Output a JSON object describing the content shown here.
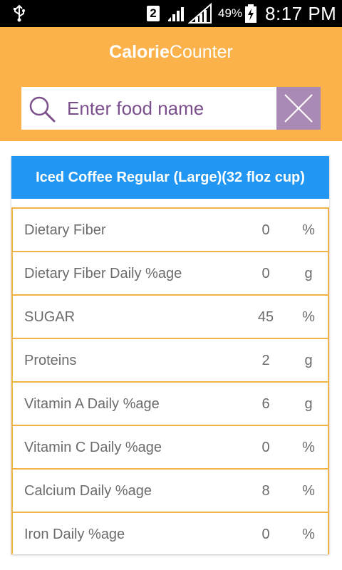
{
  "status_bar": {
    "sim_slot": "2",
    "battery_percent": "49%",
    "time": "8:17 PM"
  },
  "app": {
    "title_bold": "Calorie",
    "title_regular": "Counter"
  },
  "search": {
    "placeholder": "Enter food name",
    "value": ""
  },
  "food": {
    "name": "Iced Coffee Regular (Large)(32 floz cup)"
  },
  "nutrients": [
    {
      "name": "Dietary Fiber",
      "value": "0",
      "unit": "%"
    },
    {
      "name": "Dietary Fiber Daily %age",
      "value": "0",
      "unit": "g"
    },
    {
      "name": "SUGAR",
      "value": "45",
      "unit": "%"
    },
    {
      "name": "Proteins",
      "value": "2",
      "unit": "g"
    },
    {
      "name": "Vitamin A Daily %age",
      "value": "6",
      "unit": "g"
    },
    {
      "name": "Vitamin C Daily %age",
      "value": "0",
      "unit": "%"
    },
    {
      "name": "Calcium Daily %age",
      "value": "8",
      "unit": "%"
    },
    {
      "name": "Iron Daily %age",
      "value": "0",
      "unit": "%"
    }
  ],
  "colors": {
    "header_bg": "#fbb24b",
    "card_header_bg": "#2196f3",
    "row_border": "#f1b347",
    "search_text": "#7a4f8c",
    "clear_button_bg": "#a98ab5"
  },
  "icons": {
    "status_usb": "usb-icon",
    "status_signal": "signal-icon",
    "status_battery": "battery-charging-icon",
    "search": "search-icon",
    "clear": "close-icon"
  }
}
